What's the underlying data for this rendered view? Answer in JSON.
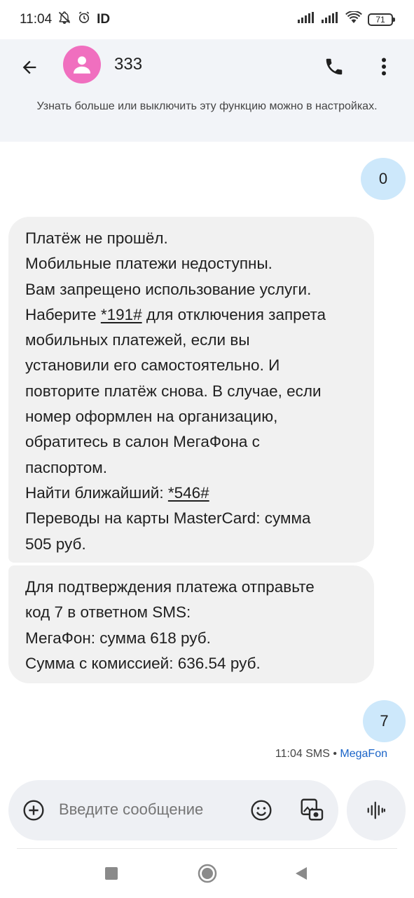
{
  "status_bar": {
    "time": "11:04",
    "left_icons": [
      "mute-icon",
      "alarm-icon",
      "id-icon"
    ],
    "id_label": "ID",
    "right_icons": [
      "signal-icon",
      "signal-icon",
      "wifi-icon",
      "battery-icon"
    ],
    "battery": "71"
  },
  "app_bar": {
    "contact_name": "333",
    "avatar_color": "#f06fbf",
    "icons": [
      "back-arrow-icon",
      "person-icon",
      "phone-icon",
      "more-vert-icon"
    ]
  },
  "banner": {
    "text": "Узнать больше или выключить эту функцию можно в настройках."
  },
  "messages": [
    {
      "direction": "outgoing",
      "text": "0"
    },
    {
      "direction": "incoming",
      "lines": [
        "Платёж не прошёл.",
        "Мобильные платежи недоступны.",
        "Вам запрещено использование услуги.",
        {
          "before": "Наберите ",
          "link": "*191#",
          "after": " для отключения запрета"
        },
        "мобильных платежей, если вы",
        "установили его самостоятельно. И",
        "повторите платёж снова. В случае, если",
        "номер оформлен на организацию,",
        "обратитесь в салон МегаФона с",
        "паспортом.",
        {
          "before": "Найти ближайший: ",
          "link": "*546#",
          "after": ""
        },
        "Переводы на карты MasterCard: сумма",
        "505 руб."
      ]
    },
    {
      "direction": "incoming",
      "lines": [
        "Для подтверждения платежа отправьте",
        "код 7 в ответном SMS:",
        "МегаФон: сумма 618 руб.",
        "Сумма с комиссией: 636.54 руб."
      ]
    },
    {
      "direction": "outgoing",
      "text": "7"
    }
  ],
  "message_meta": {
    "time": "11:04",
    "type": "SMS",
    "separator": "•",
    "carrier": "MegaFon"
  },
  "composer": {
    "placeholder": "Введите сообщение",
    "icons": [
      "add-circle-icon",
      "emoji-icon",
      "gallery-icon",
      "voice-icon"
    ]
  },
  "nav_bar": {
    "icons": [
      "recents-square-icon",
      "home-circle-icon",
      "back-triangle-icon"
    ]
  },
  "colors": {
    "app_bar_bg": "#f2f4f8",
    "outgoing_bubble": "#cde8fb",
    "incoming_bubble": "#f1f1f1",
    "carrier_link": "#1a64c8"
  }
}
